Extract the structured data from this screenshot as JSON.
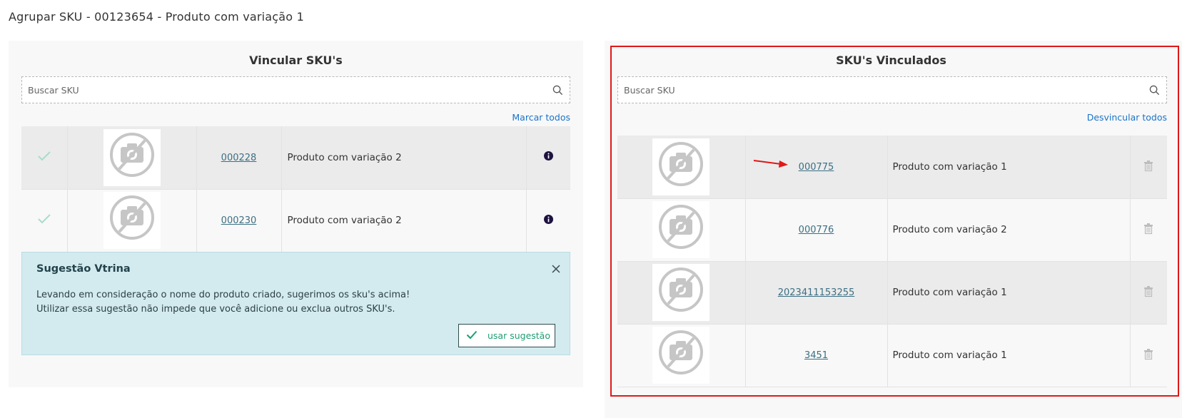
{
  "page": {
    "title": "Agrupar SKU - 00123654 - Produto com variação 1"
  },
  "left_panel": {
    "title": "Vincular SKU's",
    "search_placeholder": "Buscar SKU",
    "mark_all": "Marcar todos",
    "rows": [
      {
        "code": "000228",
        "name": "Produto com variação 2"
      },
      {
        "code": "000230",
        "name": "Produto com variação 2"
      }
    ]
  },
  "suggestion": {
    "title": "Sugestão Vtrina",
    "line1": "Levando em consideração o nome do produto criado, sugerimos os sku's acima!",
    "line2": "Utilizar essa sugestão não impede que você adicione ou exclua outros SKU's.",
    "button": "usar sugestão"
  },
  "right_panel": {
    "title": "SKU's Vinculados",
    "search_placeholder": "Buscar SKU",
    "unlink_all": "Desvincular todos",
    "rows": [
      {
        "code": "000775",
        "name": "Produto com variação 1"
      },
      {
        "code": "000776",
        "name": "Produto com variação 2"
      },
      {
        "code": "2023411153255",
        "name": "Produto com variação 1"
      },
      {
        "code": "3451",
        "name": "Produto com variação 1"
      }
    ]
  },
  "icons": {
    "search": "search-icon",
    "check": "check-icon",
    "info": "info-icon",
    "close": "close-icon",
    "trash": "trash-icon",
    "no_photo": "no-photo-icon",
    "arrow": "red-arrow-annotation"
  },
  "colors": {
    "link": "#1a73c9",
    "sku_link": "#3b6f83",
    "suggestion_bg": "#d3ebef",
    "check_light": "#a9dccd",
    "button_text": "#1f9e72",
    "highlight_frame": "#e01818"
  }
}
